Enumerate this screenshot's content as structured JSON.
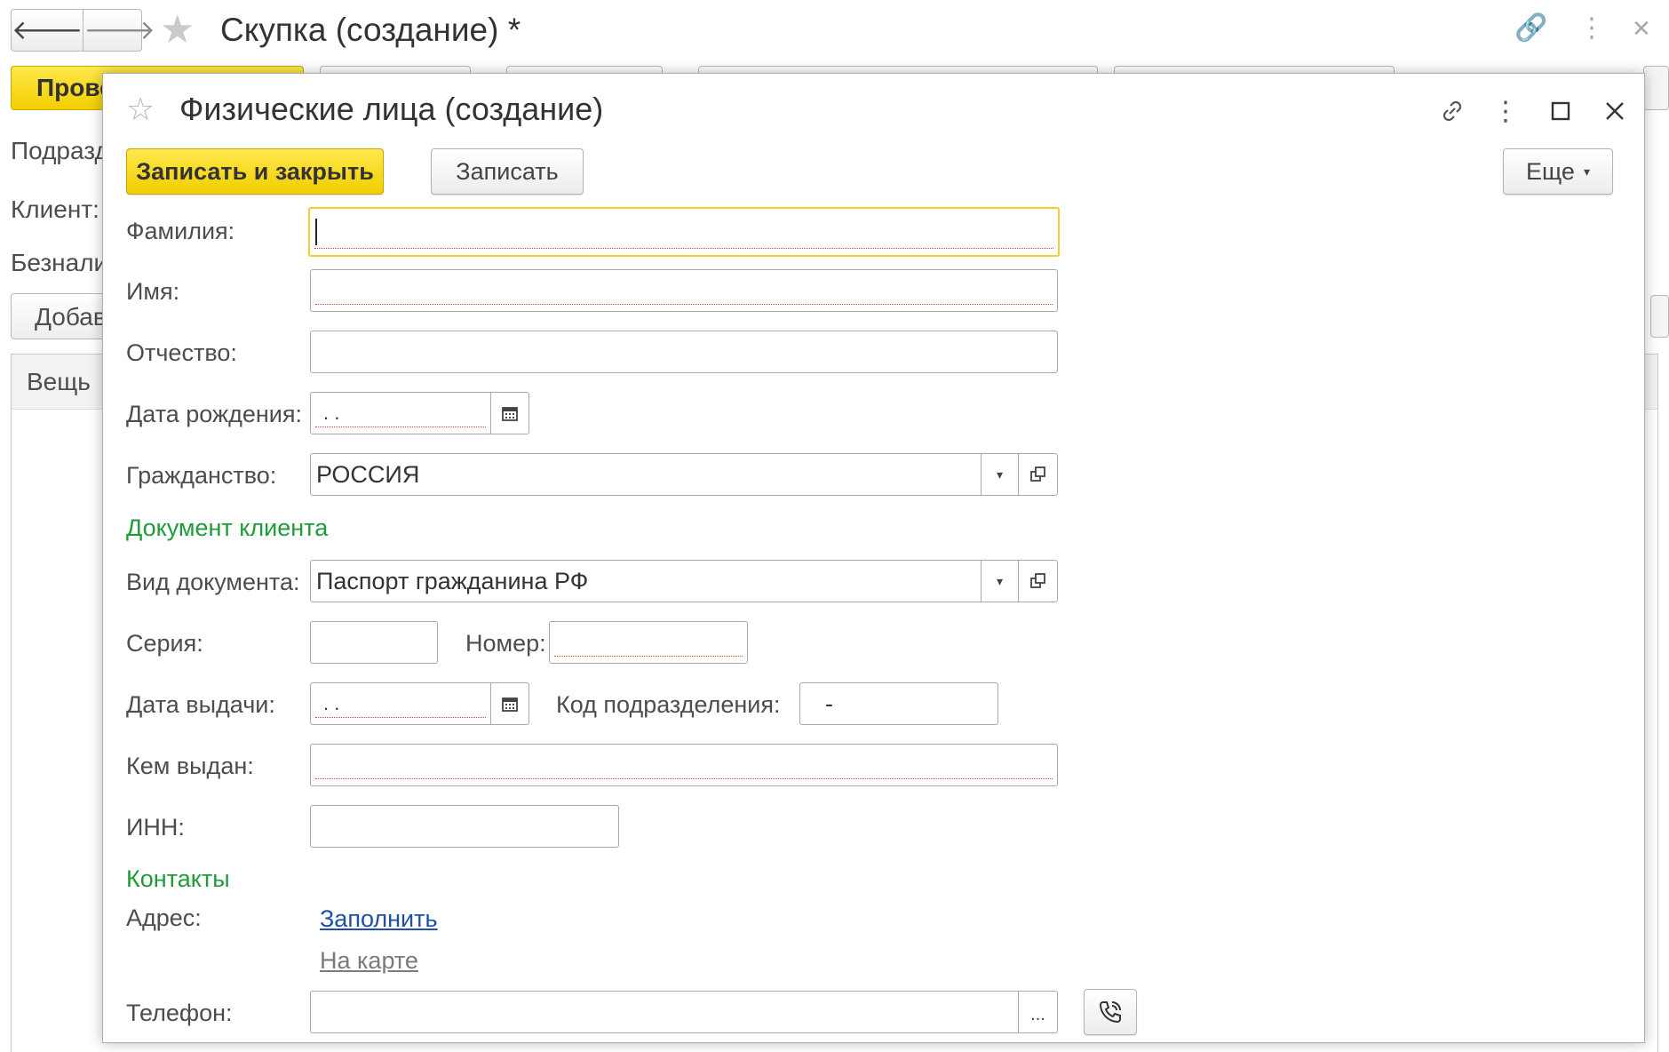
{
  "background": {
    "title": "Скупка (создание) *",
    "post_button": "Провести и закрыть",
    "labels": {
      "department": "Подразделение:",
      "client": "Клиент:",
      "cashless": "Безналичная оплата"
    },
    "add_button": "Добавить",
    "table_column": "Вещь"
  },
  "dialog": {
    "title": "Физические лица (создание)",
    "toolbar": {
      "save_close": "Записать и закрыть",
      "save": "Записать",
      "more": "Еще"
    },
    "fields": {
      "lastname": {
        "label": "Фамилия:",
        "value": ""
      },
      "firstname": {
        "label": "Имя:",
        "value": ""
      },
      "middlename": {
        "label": "Отчество:",
        "value": ""
      },
      "birthdate": {
        "label": "Дата рождения:",
        "value": " .  ."
      },
      "citizenship": {
        "label": "Гражданство:",
        "value": "РОССИЯ"
      }
    },
    "doc_section": "Документ клиента",
    "doc": {
      "type": {
        "label": "Вид документа:",
        "value": "Паспорт гражданина РФ"
      },
      "series": {
        "label": "Серия:",
        "value": ""
      },
      "number": {
        "label": "Номер:",
        "value": ""
      },
      "issue_date": {
        "label": "Дата выдачи:",
        "value": " .  ."
      },
      "dept_code": {
        "label": "Код подразделения:",
        "value": "-"
      },
      "issued_by": {
        "label": "Кем выдан:",
        "value": ""
      },
      "inn": {
        "label": "ИНН:",
        "value": ""
      }
    },
    "contacts_section": "Контакты",
    "contacts": {
      "address_label": "Адрес:",
      "fill_link": "Заполнить",
      "map_link": "На карте",
      "phone_label": "Телефон:",
      "phone_value": "",
      "phone_select": "..."
    }
  },
  "colors": {
    "accent_yellow": "#f2cf00",
    "section_green": "#1f9b3a",
    "link_blue": "#1f4fa8",
    "link_gray": "#7a7a7a",
    "required_mark": "#e04848"
  },
  "icons": [
    "back-arrow-icon",
    "forward-arrow-icon",
    "star-icon",
    "link-icon",
    "more-vertical-icon",
    "close-icon",
    "maximize-icon",
    "calendar-icon",
    "dropdown-arrow-icon",
    "open-icon",
    "phone-icon"
  ]
}
